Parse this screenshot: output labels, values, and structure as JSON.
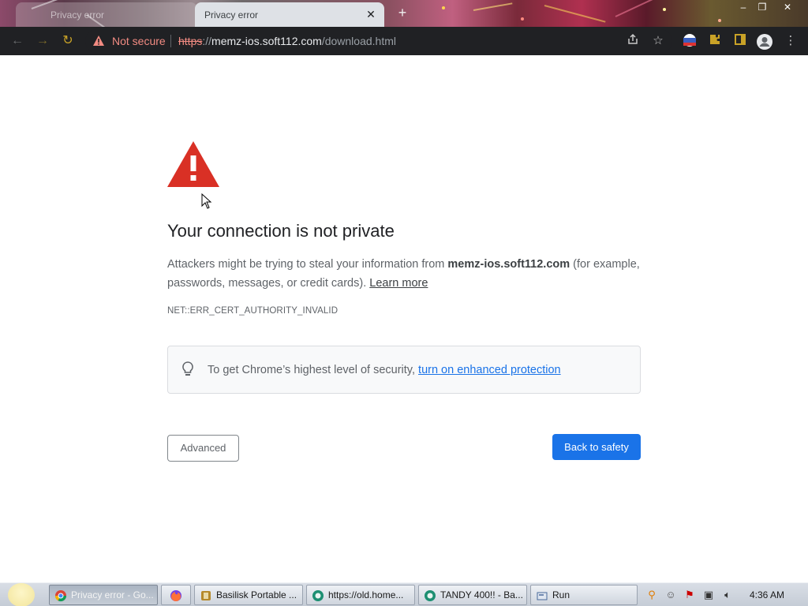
{
  "browser": {
    "tabs": [
      {
        "label": "Privacy error"
      },
      {
        "label": "Privacy error"
      }
    ],
    "newtab_glyph": "+",
    "window_controls": [
      "–",
      "❐",
      "✕"
    ],
    "nav": {
      "back": "←",
      "forward": "→",
      "reload": "↻"
    },
    "omnibox": {
      "security_label": "Not secure",
      "url_scheme": "https",
      "url_sep": "://",
      "url_host": "memz-ios.soft112.com",
      "url_path": "/download.html"
    },
    "toolbar_icons": [
      "share-icon",
      "star-icon",
      "profile-flag-icon",
      "extensions-icon",
      "side-panel-icon",
      "account-icon",
      "menu-icon"
    ]
  },
  "page": {
    "heading": "Your connection is not private",
    "desc_before": "Attackers might be trying to steal your information from ",
    "desc_host": "memz-ios.soft112.com",
    "desc_after": " (for example, passwords, messages, or credit cards). ",
    "learn_more": "Learn more",
    "error_code": "NET::ERR_CERT_AUTHORITY_INVALID",
    "security_tip_before": "To get Chrome’s highest level of security, ",
    "security_tip_link": "turn on enhanced protection",
    "advanced_button": "Advanced",
    "back_button": "Back to safety",
    "colors": {
      "warning_red": "#d93025",
      "link_blue": "#1a73e8",
      "primary_button": "#1a73e8"
    }
  },
  "taskbar": {
    "items": [
      {
        "label": "Privacy error - Go...",
        "icon": "chrome-icon"
      },
      {
        "label": "",
        "icon": "firefox-icon"
      },
      {
        "label": "Basilisk Portable ...",
        "icon": "basilisk-icon"
      },
      {
        "label": "https://old.home...",
        "icon": "browser-icon"
      },
      {
        "label": "TANDY 400!! - Ba...",
        "icon": "browser-icon"
      },
      {
        "label": "Run",
        "icon": "run-icon"
      }
    ],
    "clock": "4:36 AM"
  }
}
